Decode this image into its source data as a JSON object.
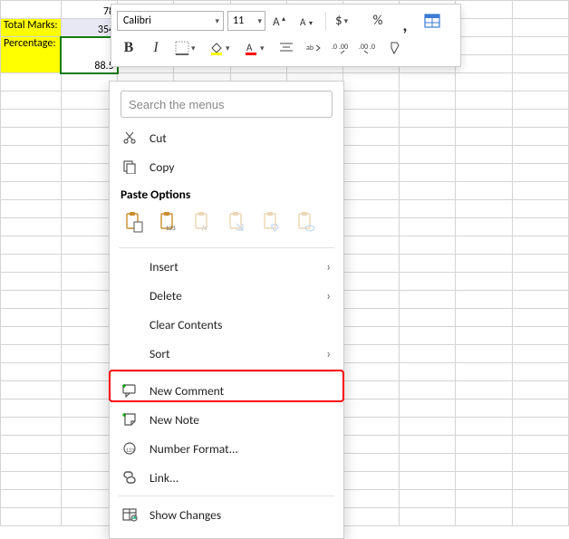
{
  "sheet": {
    "a1": "",
    "b1": "78",
    "a2": "Total Marks:",
    "b2": "354",
    "a3": "Percentage:",
    "b3": "88.5"
  },
  "mini": {
    "font": "Calibri",
    "size": "11"
  },
  "ctx": {
    "search_placeholder": "Search the menus",
    "cut": "Cut",
    "copy": "Copy",
    "paste_hdr": "Paste Options",
    "insert": "Insert",
    "delete": "Delete",
    "clear": "Clear Contents",
    "sort": "Sort",
    "new_comment": "New Comment",
    "new_note": "New Note",
    "number_format": "Number Format...",
    "link": "Link...",
    "show_changes": "Show Changes"
  }
}
